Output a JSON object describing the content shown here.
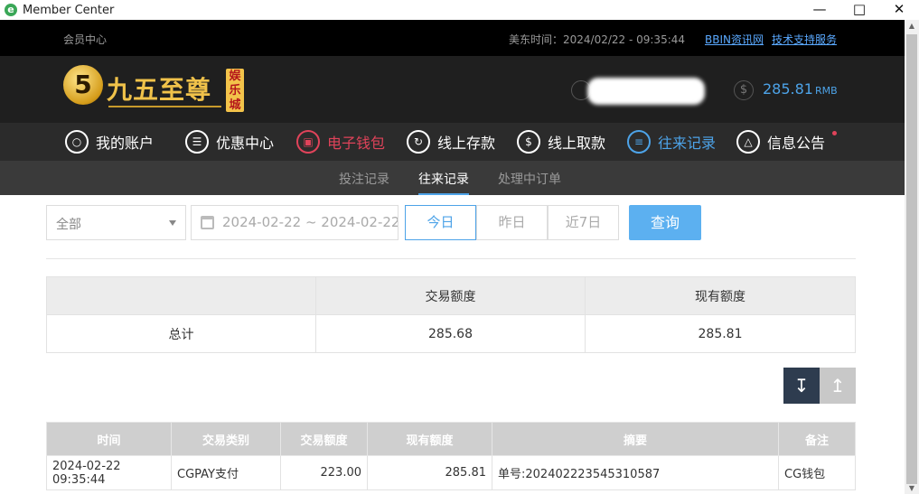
{
  "window": {
    "title": "Member Center",
    "app_icon": "ie-e-icon"
  },
  "topbar": {
    "member_center": "会员中心",
    "time_label": "美东时间：2024/02/22 - 09:35:44",
    "links": [
      "BBIN资讯网",
      "技术支持服务"
    ]
  },
  "brand": {
    "logo_number": "5",
    "logo_text": "九五至尊",
    "badge_text": "娱乐城"
  },
  "account": {
    "balance": "285.81",
    "currency": "RMB"
  },
  "nav": {
    "items": [
      {
        "label": "我的账户",
        "icon": "user-icon",
        "state": "normal"
      },
      {
        "label": "优惠中心",
        "icon": "gift-icon",
        "state": "normal"
      },
      {
        "label": "电子钱包",
        "icon": "wallet-icon",
        "state": "highlight"
      },
      {
        "label": "线上存款",
        "icon": "deposit-icon",
        "state": "normal"
      },
      {
        "label": "线上取款",
        "icon": "withdraw-icon",
        "state": "normal"
      },
      {
        "label": "往来记录",
        "icon": "records-icon",
        "state": "active"
      },
      {
        "label": "信息公告",
        "icon": "bell-icon",
        "state": "normal"
      }
    ]
  },
  "subnav": {
    "items": [
      {
        "label": "投注记录",
        "active": false
      },
      {
        "label": "往来记录",
        "active": true
      },
      {
        "label": "处理中订单",
        "active": false
      }
    ]
  },
  "filters": {
    "type_select": "全部",
    "date_range": "2024-02-22 ~ 2024-02-22",
    "quick": [
      "今日",
      "昨日",
      "近7日"
    ],
    "quick_active": "今日",
    "query_label": "查询"
  },
  "summary": {
    "headers": [
      "",
      "交易额度",
      "现有额度"
    ],
    "row": [
      "总计",
      "285.68",
      "285.81"
    ]
  },
  "records": {
    "headers": [
      "时间",
      "交易类别",
      "交易额度",
      "现有额度",
      "摘要",
      "备注"
    ],
    "rows": [
      [
        "2024-02-22 09:35:44",
        "CGPAY支付",
        "223.00",
        "285.81",
        "单号:202402223545310587",
        "CG钱包"
      ]
    ]
  },
  "colors": {
    "accent_blue": "#4da3e8",
    "highlight_red": "#e0435a",
    "brand_gold": "#f0c24a",
    "header_dark": "#000000"
  }
}
